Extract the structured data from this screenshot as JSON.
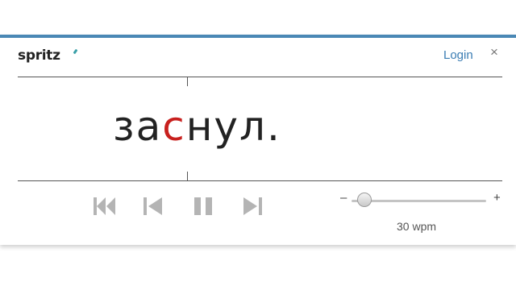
{
  "header": {
    "logo_text": "spritz",
    "login_label": "Login",
    "close_label": "×"
  },
  "reader": {
    "word_before": "за",
    "word_focus": "с",
    "word_after": "нул.",
    "focus_color": "#c8201e"
  },
  "controls": {
    "icons": [
      "skip-to-start-icon",
      "step-back-icon",
      "pause-icon",
      "step-forward-icon"
    ]
  },
  "speed": {
    "minus_label": "–",
    "plus_label": "+",
    "value_label": "30 wpm",
    "slider_fraction": 0.05
  },
  "colors": {
    "accent": "#4a88b5",
    "link": "#3b7db3",
    "icon": "#b4b4b4"
  }
}
